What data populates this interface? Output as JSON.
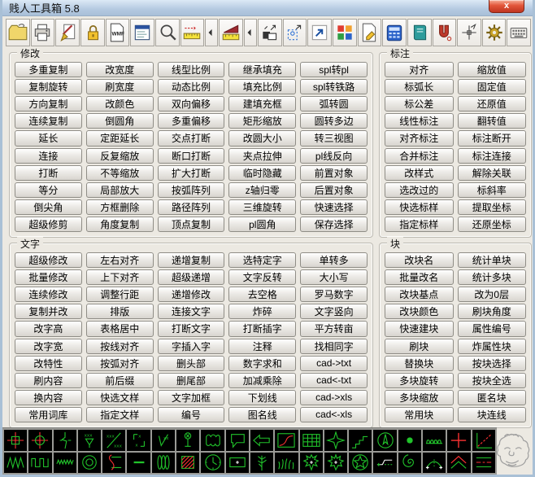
{
  "window": {
    "title": "贱人工具箱 5.8",
    "close_label": "x"
  },
  "colors": {
    "icon_green": "#21c32b",
    "icon_red": "#ff3232",
    "close_red": "#c03520",
    "titlebar_blue": "#b4c9e0"
  },
  "toolbar": {
    "buttons": [
      {
        "name": "open-drawing-button",
        "icon": "folder-open-icon",
        "shape": "folder"
      },
      {
        "name": "print-button",
        "icon": "printer-icon",
        "shape": "printer"
      },
      {
        "name": "purge-clean-button",
        "icon": "broom-doc-icon",
        "shape": "broom"
      },
      {
        "name": "lock-button",
        "icon": "lock-icon",
        "shape": "lock"
      },
      {
        "name": "wmf-export-button",
        "icon": "wmf-file-icon",
        "shape": "wmf"
      },
      {
        "name": "properties-button",
        "icon": "blue-document-icon",
        "shape": "docBlue"
      },
      {
        "name": "zoom-view-button",
        "icon": "magnifier-icon",
        "shape": "magnifier"
      },
      {
        "name": "measure-button",
        "icon": "ruler-arrow-icon",
        "shape": "ruler"
      },
      {
        "name": "measure-flip-button",
        "icon": "small-left-arrow-icon",
        "shape": "arrowL",
        "narrow": true
      },
      {
        "name": "slope-annotate-button",
        "icon": "slope-ruler-icon",
        "shape": "slopeRuler"
      },
      {
        "name": "slope-flip-button",
        "icon": "small-left-arrow-icon",
        "shape": "arrowL",
        "narrow": true
      },
      {
        "name": "stretch-move-button",
        "icon": "stretch-squares-icon",
        "shape": "stretch"
      },
      {
        "name": "selection-mode-button",
        "icon": "dotted-selection-icon",
        "shape": "dotted"
      },
      {
        "name": "shortcut-button",
        "icon": "diagonal-arrow-box-icon",
        "shape": "shortcut"
      },
      {
        "name": "color-tools-button",
        "icon": "color-grid-icon",
        "shape": "colorGrid"
      },
      {
        "name": "edit-document-button",
        "icon": "document-pencil-icon",
        "shape": "docPencil"
      },
      {
        "name": "calculator-button",
        "icon": "calculator-icon",
        "shape": "calculator"
      },
      {
        "name": "manual-book-button",
        "icon": "book-icon",
        "shape": "book"
      },
      {
        "name": "osnap-magnet-button",
        "icon": "magnet-icon",
        "shape": "magnet"
      },
      {
        "name": "crosshair-config-button",
        "icon": "crosshair-arrow-icon",
        "shape": "crosshairArrow"
      },
      {
        "name": "settings-button",
        "icon": "gear-icon",
        "shape": "gear"
      },
      {
        "name": "keyboard-button",
        "icon": "keyboard-icon",
        "shape": "keyboard"
      }
    ]
  },
  "groups": [
    {
      "id": "modify",
      "title": "修改",
      "columns": [
        [
          "多重复制",
          "复制旋转",
          "方向复制",
          "连续复制",
          "延长",
          "连接",
          "打断",
          "等分",
          "倒尖角",
          "超级修剪"
        ],
        [
          "改宽度",
          "刷宽度",
          "改颜色",
          "倒圆角",
          "定距延长",
          "反复缩放",
          "不等缩放",
          "局部放大",
          "方框删除",
          "角度复制"
        ],
        [
          "线型比例",
          "动态比例",
          "双向偏移",
          "多重偏移",
          "交点打断",
          "断口打断",
          "扩大打断",
          "按弧阵列",
          "路径阵列",
          "顶点复制"
        ],
        [
          "继承填充",
          "填充比例",
          "建填充框",
          "矩形缩放",
          "改圆大小",
          "夹点拉伸",
          "临时隐藏",
          "z轴归零",
          "三维旋转",
          "pl圆角"
        ],
        [
          "spl转pl",
          "spl转铁路",
          "弧转圆",
          "圆转多边",
          "转三视图",
          "pl线反向",
          "前置对象",
          "后置对象",
          "快速选择",
          "保存选择"
        ]
      ]
    },
    {
      "id": "dimension",
      "title": "标注",
      "columns": [
        [
          "对齐",
          "标弧长",
          "标公差",
          "线性标注",
          "对齐标注",
          "合并标注",
          "改样式",
          "选改过的",
          "快选标样",
          "指定标样"
        ],
        [
          "缩放值",
          "固定值",
          "还原值",
          "翻转值",
          "标注断开",
          "标注连接",
          "解除关联",
          "标斜率",
          "提取坐标",
          "还原坐标"
        ]
      ]
    },
    {
      "id": "text",
      "title": "文字",
      "columns": [
        [
          "超级修改",
          "批量修改",
          "连续修改",
          "复制并改",
          "改字高",
          "改字宽",
          "改特性",
          "刷内容",
          "换内容",
          "常用词库"
        ],
        [
          "左右对齐",
          "上下对齐",
          "调整行距",
          "排版",
          "表格居中",
          "按线对齐",
          "按弧对齐",
          "前后缀",
          "快选文样",
          "指定文样"
        ],
        [
          "递增复制",
          "超级递增",
          "递增修改",
          "连接文字",
          "打断文字",
          "字插入字",
          "删头部",
          "删尾部",
          "文字加框",
          "编号"
        ],
        [
          "选特定字",
          "文字反转",
          "去空格",
          "炸碎",
          "打断插字",
          "注释",
          "数字求和",
          "加减乘除",
          "下划线",
          "图名线"
        ],
        [
          "单转多",
          "大小写",
          "罗马数字",
          "文字竖向",
          "平方转亩",
          "找相同字",
          "cad->txt",
          "cad<-txt",
          "cad->xls",
          "cad<-xls"
        ]
      ]
    },
    {
      "id": "block",
      "title": "块",
      "columns": [
        [
          "改块名",
          "批量改名",
          "改块基点",
          "改块颜色",
          "快速建块",
          "刷块",
          "替换块",
          "多块旋转",
          "多块缩放",
          "常用块"
        ],
        [
          "统计单块",
          "统计多块",
          "改为0层",
          "刷块角度",
          "属性编号",
          "炸属性块",
          "按块选择",
          "按块全选",
          "匿名块",
          "块连线"
        ]
      ]
    }
  ],
  "bottom_strip": {
    "rows": [
      [
        {
          "name": "coordinate-mark-icon",
          "shape": "crossSquare"
        },
        {
          "name": "center-mark-icon",
          "shape": "crossCircle"
        },
        {
          "name": "break-line-icon",
          "shape": "breakSym"
        },
        {
          "name": "weld-symbol-icon",
          "shape": "weld"
        },
        {
          "name": "slope-ratio-icon",
          "shape": "slope"
        },
        {
          "name": "corner-marks-icon",
          "shape": "corners"
        },
        {
          "name": "roughness-symbol-icon",
          "shape": "rough"
        },
        {
          "name": "signpost-icon",
          "shape": "signpost"
        },
        {
          "name": "revision-cloud-icon",
          "shape": "cloud"
        },
        {
          "name": "leader-callout-icon",
          "shape": "callout"
        },
        {
          "name": "arrow-left-icon",
          "shape": "arrowLeftBig"
        },
        {
          "name": "curve-chart-icon",
          "shape": "curveBox"
        },
        {
          "name": "table-grid-icon",
          "shape": "grid"
        },
        {
          "name": "star-four-icon",
          "shape": "star4"
        },
        {
          "name": "stairs-icon",
          "shape": "stairs"
        },
        {
          "name": "north-compass-icon",
          "shape": "compass"
        },
        {
          "name": "solid-dot-icon",
          "shape": "dot"
        },
        {
          "name": "hook-row-icon",
          "shape": "hooks"
        },
        {
          "name": "red-cross-icon",
          "shape": "redCross"
        },
        {
          "name": "axis-diagonal-icon",
          "shape": "axisDiag"
        }
      ],
      [
        {
          "name": "zigzag-wave-icon",
          "shape": "wave"
        },
        {
          "name": "square-wave-icon",
          "shape": "sqWave"
        },
        {
          "name": "small-zigzag-icon",
          "shape": "smallZigzag"
        },
        {
          "name": "concentric-circles-icon",
          "shape": "rings"
        },
        {
          "name": "pipe-hook-icon",
          "shape": "pipeHook"
        },
        {
          "name": "dash-line-icon",
          "shape": "dash"
        },
        {
          "name": "spring-coil-icon",
          "shape": "spring"
        },
        {
          "name": "hatch-square-icon",
          "shape": "hatchSq"
        },
        {
          "name": "clock-icon",
          "shape": "clock"
        },
        {
          "name": "rect-plus-icon",
          "shape": "rectPlus"
        },
        {
          "name": "tree-branch-icon",
          "shape": "tree"
        },
        {
          "name": "grass-icon",
          "shape": "grass"
        },
        {
          "name": "burst-plus-icon",
          "shape": "burst"
        },
        {
          "name": "burst-plus-2-icon",
          "shape": "burst2"
        },
        {
          "name": "star-circle-icon",
          "shape": "starCircle"
        },
        {
          "name": "step-dots-icon",
          "shape": "stepDots"
        },
        {
          "name": "spiral-icon",
          "shape": "spiral"
        },
        {
          "name": "arc-dots-icon",
          "shape": "arcDots"
        },
        {
          "name": "roof-angle-icon",
          "shape": "roof"
        },
        {
          "name": "parallel-dashdot-icon",
          "shape": "parallels"
        }
      ]
    ]
  }
}
